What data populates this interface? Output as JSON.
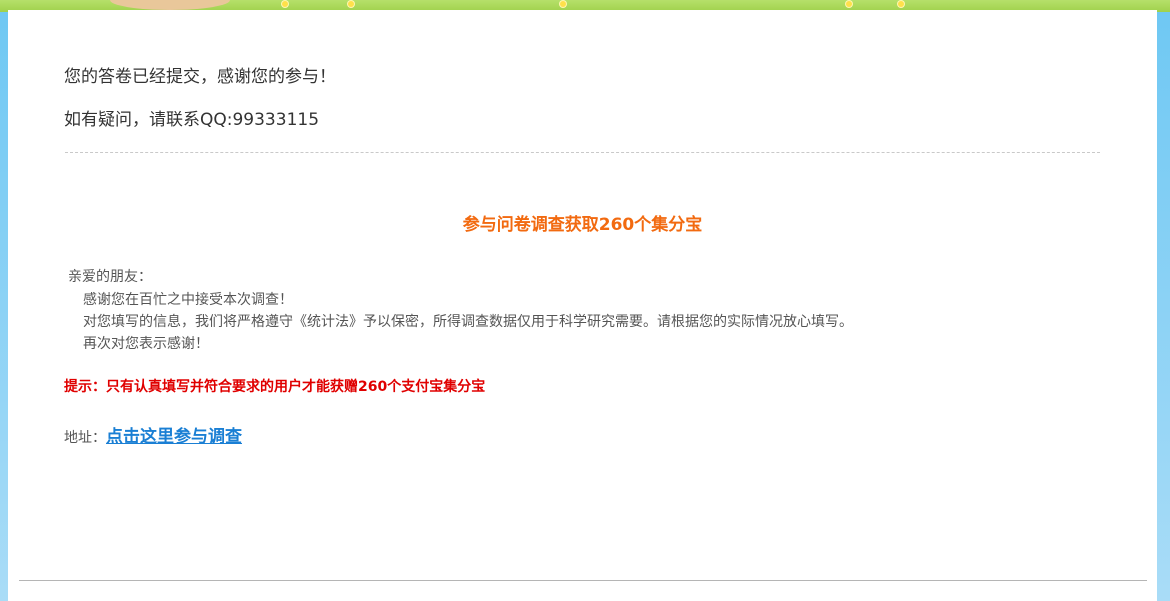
{
  "confirmation": {
    "submitted_text": "您的答卷已经提交，感谢您的参与！",
    "contact_text": "如有疑问，请联系QQ:99333115"
  },
  "promo": {
    "headline": "参与问卷调查获取260个集分宝",
    "greeting": "亲爱的朋友：",
    "lines": [
      "感谢您在百忙之中接受本次调查！",
      "对您填写的信息，我们将严格遵守《统计法》予以保密，所得调查数据仅用于科学研究需要。请根据您的实际情况放心填写。",
      "再次对您表示感谢！"
    ],
    "tip": "提示：只有认真填写并符合要求的用户才能获赠260个支付宝集分宝",
    "address_label": "地址：",
    "address_link": "点击这里参与调查"
  },
  "colors": {
    "headline": "#f26a10",
    "tip": "#e00000",
    "link": "#1a7fd4",
    "page_background": "#7ccdf2"
  }
}
